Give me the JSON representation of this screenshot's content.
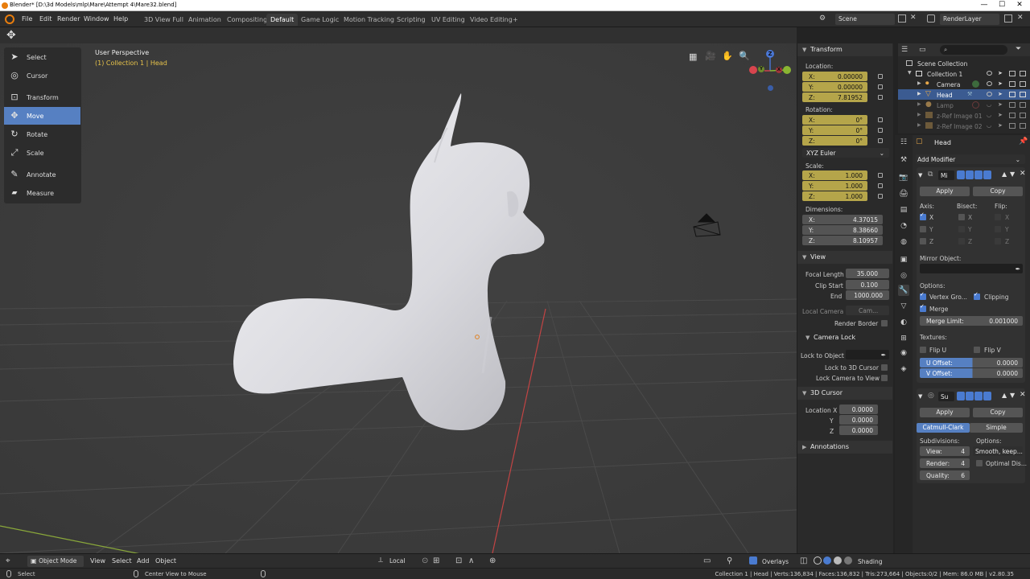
{
  "window": {
    "title": "Blender* [D:\\3d Models\\mlp\\Mare\\Attempt 4\\Mare32.blend]",
    "minimize": "—",
    "maximize": "☐",
    "close": "✕"
  },
  "menu": [
    "File",
    "Edit",
    "Render",
    "Window",
    "Help"
  ],
  "workspaces": [
    "3D View Full",
    "Animation",
    "Compositing",
    "Default",
    "Game Logic",
    "Motion Tracking",
    "Scripting",
    "UV Editing",
    "Video Editing"
  ],
  "active_workspace": "Default",
  "add_workspace": "+",
  "scene": {
    "name": "Scene",
    "render_layer": "RenderLayer"
  },
  "toolbar": {
    "tools": [
      {
        "label": "Select",
        "icon": "select-icon",
        "glyph": "➤"
      },
      {
        "label": "Cursor",
        "icon": "cursor-icon",
        "glyph": "◎"
      },
      {
        "label": "Transform",
        "icon": "transform-icon",
        "glyph": "⊡"
      },
      {
        "label": "Move",
        "icon": "move-icon",
        "glyph": "✥"
      },
      {
        "label": "Rotate",
        "icon": "rotate-icon",
        "glyph": "↻"
      },
      {
        "label": "Scale",
        "icon": "scale-icon",
        "glyph": "⤢"
      },
      {
        "label": "Annotate",
        "icon": "annotate-icon",
        "glyph": "✎"
      },
      {
        "label": "Measure",
        "icon": "measure-icon",
        "glyph": "📏"
      }
    ],
    "selected": "Move"
  },
  "viewport": {
    "perspective": "User Perspective",
    "collection": "(1) Collection 1 | Head",
    "gizmo": {
      "x": "X",
      "y": "Y",
      "z": "Z"
    }
  },
  "npanel": {
    "transform": {
      "header": "Transform",
      "location_label": "Location:",
      "location": [
        {
          "k": "X:",
          "v": "0.00000"
        },
        {
          "k": "Y:",
          "v": "0.00000"
        },
        {
          "k": "Z:",
          "v": "7.81952"
        }
      ],
      "rotation_label": "Rotation:",
      "rotation": [
        {
          "k": "X:",
          "v": "0°"
        },
        {
          "k": "Y:",
          "v": "0°"
        },
        {
          "k": "Z:",
          "v": "0°"
        }
      ],
      "rotation_mode": "XYZ Euler",
      "scale_label": "Scale:",
      "scale": [
        {
          "k": "X:",
          "v": "1.000"
        },
        {
          "k": "Y:",
          "v": "1.000"
        },
        {
          "k": "Z:",
          "v": "1.000"
        }
      ],
      "dimensions_label": "Dimensions:",
      "dimensions": [
        {
          "k": "X:",
          "v": "4.37015"
        },
        {
          "k": "Y:",
          "v": "8.38660"
        },
        {
          "k": "Z:",
          "v": "8.10957"
        }
      ]
    },
    "view": {
      "header": "View",
      "focal_length_label": "Focal Length",
      "focal_length": "35.000",
      "clip_start_label": "Clip Start",
      "clip_start": "0.100",
      "clip_end_label": "End",
      "clip_end": "1000.000",
      "local_camera_label": "Local Camera",
      "local_camera": "Cam...",
      "render_border": "Render Border"
    },
    "camera_lock": {
      "header": "Camera Lock",
      "lock_to_object": "Lock to Object",
      "lock_to_cursor": "Lock to 3D Cursor",
      "lock_camera_to_view": "Lock Camera to View"
    },
    "cursor": {
      "header": "3D Cursor",
      "location_x_label": "Location X",
      "y_label": "Y",
      "z_label": "Z",
      "x": "0.0000",
      "y": "0.0000",
      "z": "0.0000"
    },
    "annotations_header": "Annotations"
  },
  "outliner": {
    "search_placeholder": "",
    "rows": [
      {
        "label": "Scene Collection",
        "icon": "scene-collection-icon",
        "state": "normal"
      },
      {
        "label": "Collection 1",
        "icon": "collection-icon",
        "state": "normal"
      },
      {
        "label": "Camera",
        "icon": "camera-icon",
        "state": "normal"
      },
      {
        "label": "Head",
        "icon": "mesh-icon",
        "state": "selected"
      },
      {
        "label": "Lamp",
        "icon": "lamp-icon",
        "state": "dim"
      },
      {
        "label": "z-Ref Image 01",
        "icon": "image-icon",
        "state": "dim"
      },
      {
        "label": "z-Ref Image 02",
        "icon": "image-icon",
        "state": "dim"
      }
    ]
  },
  "properties": {
    "object_name": "Head",
    "add_modifier": "Add Modifier",
    "mirror": {
      "name": "Mi",
      "apply": "Apply",
      "copy": "Copy",
      "axis_label": "Axis:",
      "bisect_label": "Bisect:",
      "flip_label": "Flip:",
      "axes": [
        "X",
        "Y",
        "Z"
      ],
      "mirror_object_label": "Mirror Object:",
      "options_label": "Options:",
      "vertex_groups": "Vertex Gro...",
      "clipping": "Clipping",
      "merge": "Merge",
      "merge_limit_label": "Merge Limit:",
      "merge_limit": "0.001000",
      "textures_label": "Textures:",
      "flip_u": "Flip U",
      "flip_v": "Flip V",
      "u_offset_label": "U Offset:",
      "u_offset": "0.0000",
      "v_offset_label": "V Offset:",
      "v_offset": "0.0000"
    },
    "subsurf": {
      "name": "Su",
      "apply": "Apply",
      "copy": "Copy",
      "catmull": "Catmull-Clark",
      "simple": "Simple",
      "subdivisions_label": "Subdivisions:",
      "options_label": "Options:",
      "view_label": "View:",
      "view": "4",
      "render_label": "Render:",
      "render": "4",
      "quality_label": "Quality:",
      "quality": "6",
      "uv_smooth": "Smooth, keep...",
      "optimal_display": "Optimal Dis..."
    }
  },
  "viewport_header": {
    "mode": "Object Mode",
    "menus": [
      "View",
      "Select",
      "Add",
      "Object"
    ],
    "orientation": "Local",
    "overlays": "Overlays",
    "shading": "Shading"
  },
  "status": {
    "left": "Select",
    "mid": "Center View to Mouse",
    "right": "Collection 1 | Head | Verts:136,834 | Faces:136,832 | Tris:273,664 | Objects:0/2 | Mem: 86.0 MB | v2.80.35"
  },
  "colors": {
    "accent": "#5680c2",
    "animated_field": "#b5a54a",
    "viewport_bg": "#3d3d3d"
  }
}
